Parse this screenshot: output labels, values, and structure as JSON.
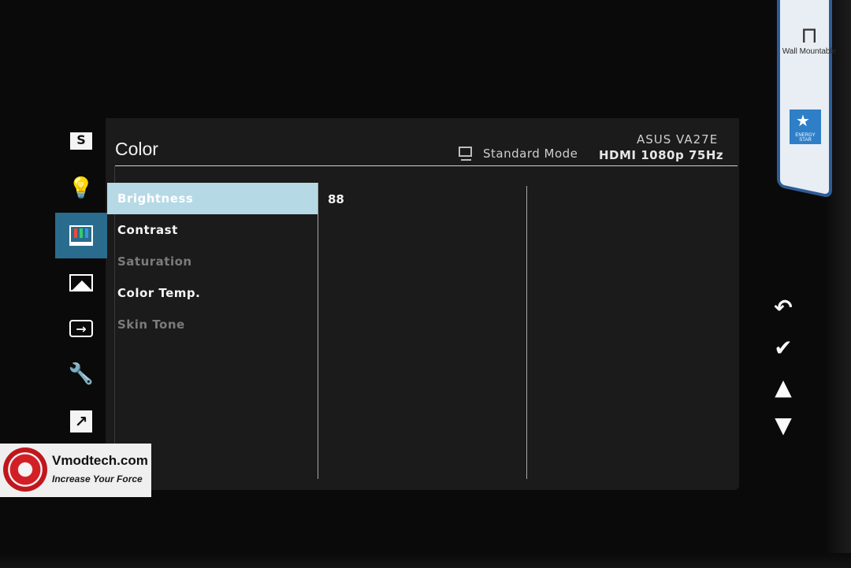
{
  "header": {
    "title": "Color",
    "model": "ASUS VA27E",
    "mode": "Standard Mode",
    "signal": "HDMI 1080p 75Hz"
  },
  "sidebar": {
    "items": [
      {
        "name": "splendid",
        "icon": "s-icon"
      },
      {
        "name": "blue-light-filter",
        "icon": "lightbulb-icon"
      },
      {
        "name": "color",
        "icon": "color-bars-icon",
        "active": true
      },
      {
        "name": "image",
        "icon": "image-icon"
      },
      {
        "name": "input-select",
        "icon": "input-icon"
      },
      {
        "name": "system-setup",
        "icon": "wrench-icon"
      },
      {
        "name": "shortcut",
        "icon": "shortcut-arrow-icon"
      }
    ]
  },
  "menu": {
    "items": [
      {
        "label": "Brightness",
        "state": "selected"
      },
      {
        "label": "Contrast",
        "state": "enabled"
      },
      {
        "label": "Saturation",
        "state": "disabled"
      },
      {
        "label": "Color Temp.",
        "state": "enabled"
      },
      {
        "label": "Skin Tone",
        "state": "disabled"
      }
    ]
  },
  "value_panel": {
    "brightness_value": "88"
  },
  "hardware_buttons": [
    {
      "name": "back",
      "icon": "return-icon"
    },
    {
      "name": "confirm",
      "icon": "check-icon"
    },
    {
      "name": "up",
      "icon": "triangle-up-icon"
    },
    {
      "name": "down",
      "icon": "triangle-down-icon"
    }
  ],
  "sticker": {
    "wall_label": "Wall Mountable",
    "energy_label": "ENERGY STAR"
  },
  "watermark": {
    "title": "Vmodtech.com",
    "subtitle": "Increase Your Force"
  },
  "colors": {
    "osd_bg": "#1b1b1b",
    "active_tab": "#2a6c8e",
    "selected_item": "#b6d9e6",
    "disabled_text": "#7b7b7b"
  }
}
